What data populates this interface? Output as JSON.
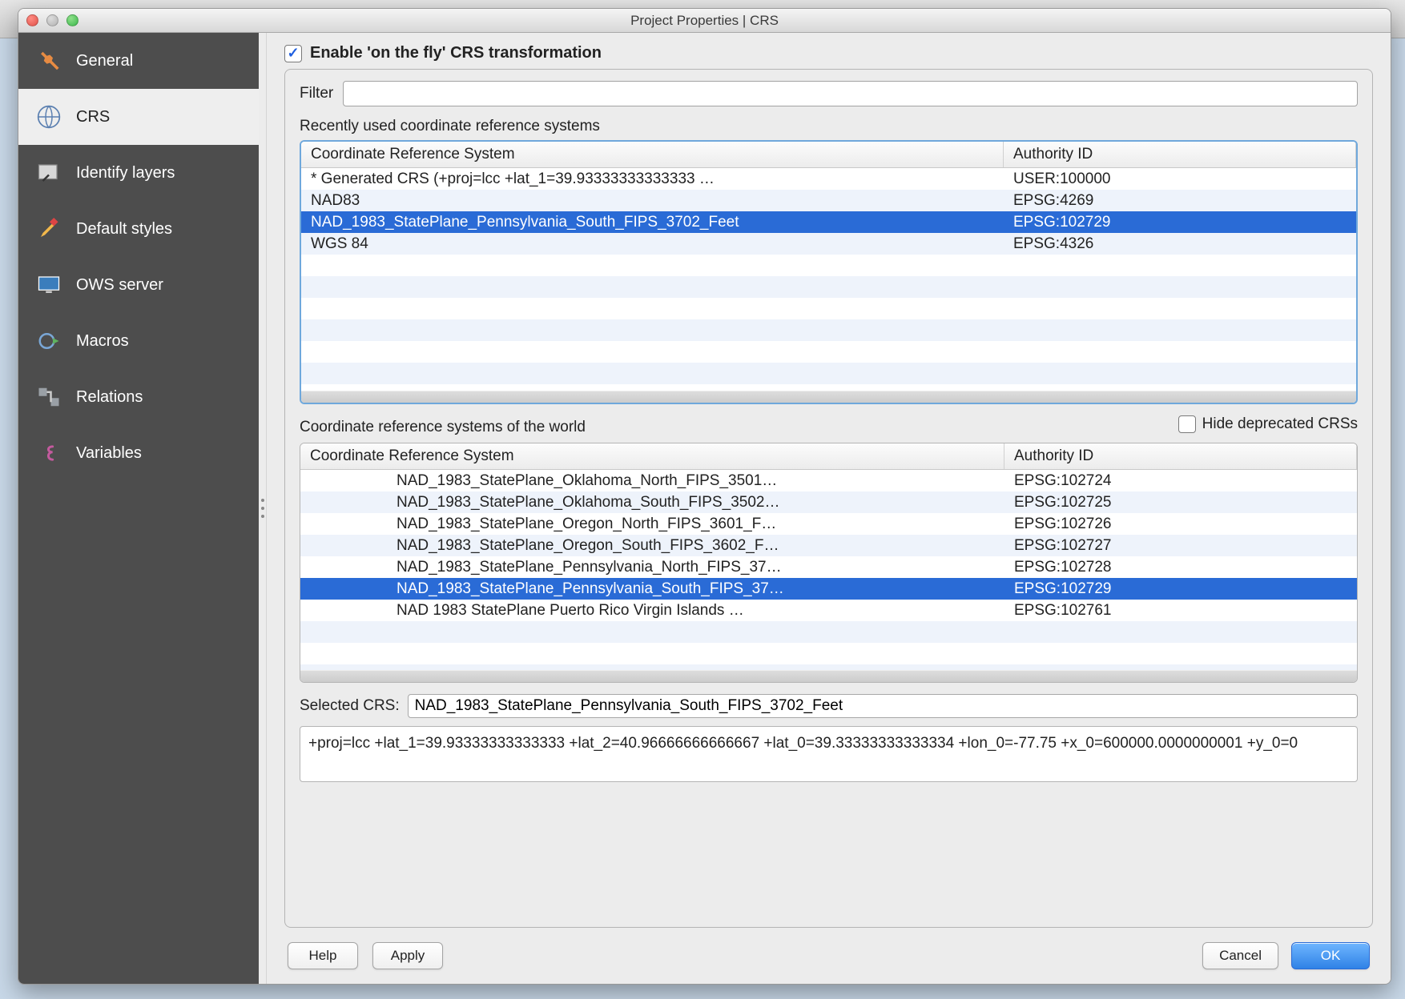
{
  "window": {
    "title": "Project Properties | CRS"
  },
  "sidebar": {
    "items": [
      {
        "label": "General"
      },
      {
        "label": "CRS"
      },
      {
        "label": "Identify layers"
      },
      {
        "label": "Default styles"
      },
      {
        "label": "OWS server"
      },
      {
        "label": "Macros"
      },
      {
        "label": "Relations"
      },
      {
        "label": "Variables"
      }
    ]
  },
  "crsPage": {
    "enable_label": "Enable 'on the fly' CRS transformation",
    "filter_label": "Filter",
    "recent_label": "Recently used coordinate reference systems",
    "world_label": "Coordinate reference systems of the world",
    "hide_deprecated_label": "Hide deprecated CRSs",
    "selected_label": "Selected CRS:",
    "selected_value": "NAD_1983_StatePlane_Pennsylvania_South_FIPS_3702_Feet",
    "proj_string": "+proj=lcc +lat_1=39.93333333333333 +lat_2=40.96666666666667 +lat_0=39.33333333333334 +lon_0=-77.75 +x_0=600000.0000000001 +y_0=0",
    "columns": {
      "crs": "Coordinate Reference System",
      "auth": "Authority ID"
    },
    "recent_rows": [
      {
        "name": "* Generated CRS (+proj=lcc +lat_1=39.93333333333333 …",
        "auth": "USER:100000",
        "selected": false
      },
      {
        "name": "NAD83",
        "auth": "EPSG:4269",
        "selected": false
      },
      {
        "name": "NAD_1983_StatePlane_Pennsylvania_South_FIPS_3702_Feet",
        "auth": "EPSG:102729",
        "selected": true
      },
      {
        "name": "WGS 84",
        "auth": "EPSG:4326",
        "selected": false
      }
    ],
    "world_rows": [
      {
        "name": "NAD_1983_StatePlane_Oklahoma_North_FIPS_3501…",
        "auth": "EPSG:102724",
        "selected": false
      },
      {
        "name": "NAD_1983_StatePlane_Oklahoma_South_FIPS_3502…",
        "auth": "EPSG:102725",
        "selected": false
      },
      {
        "name": "NAD_1983_StatePlane_Oregon_North_FIPS_3601_F…",
        "auth": "EPSG:102726",
        "selected": false
      },
      {
        "name": "NAD_1983_StatePlane_Oregon_South_FIPS_3602_F…",
        "auth": "EPSG:102727",
        "selected": false
      },
      {
        "name": "NAD_1983_StatePlane_Pennsylvania_North_FIPS_37…",
        "auth": "EPSG:102728",
        "selected": false
      },
      {
        "name": "NAD_1983_StatePlane_Pennsylvania_South_FIPS_37…",
        "auth": "EPSG:102729",
        "selected": true
      },
      {
        "name": "NAD 1983 StatePlane Puerto Rico Virgin Islands …",
        "auth": "EPSG:102761",
        "selected": false
      }
    ]
  },
  "buttons": {
    "help": "Help",
    "apply": "Apply",
    "cancel": "Cancel",
    "ok": "OK"
  }
}
